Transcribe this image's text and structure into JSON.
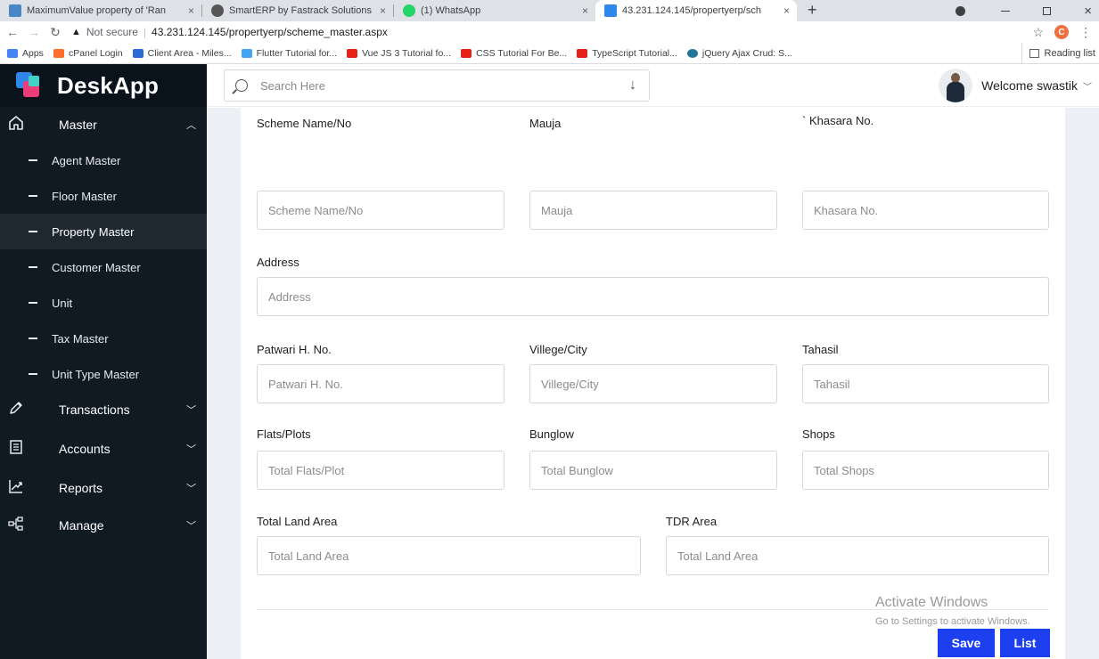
{
  "browser": {
    "tabs": [
      {
        "title": "MaximumValue property of 'Ran",
        "close": "×",
        "active": false,
        "fav_color": "#4a86c5"
      },
      {
        "title": "SmartERP by Fastrack Solutions...",
        "close": "×",
        "active": false,
        "fav_color": "#555555"
      },
      {
        "title": "(1) WhatsApp",
        "close": "×",
        "active": false,
        "fav_color": "#25d366"
      },
      {
        "title": "43.231.124.145/propertyerp/sch",
        "close": "×",
        "active": true,
        "fav_color": "#2f86eb"
      }
    ],
    "new_tab": "+",
    "url_prefix": "Not secure",
    "url": "43.231.124.145/propertyerp/scheme_master.aspx",
    "profile_initial": "C",
    "bookmarks": [
      {
        "label": "Apps",
        "color": "#4285f4"
      },
      {
        "label": "cPanel Login",
        "color": "#ff6c2c"
      },
      {
        "label": "Client Area - Miles...",
        "color": "#2d6bd4"
      },
      {
        "label": "Flutter Tutorial for...",
        "color": "#42a5f5"
      },
      {
        "label": "Vue JS 3 Tutorial fo...",
        "color": "#e62117"
      },
      {
        "label": "CSS Tutorial For Be...",
        "color": "#e62117"
      },
      {
        "label": "TypeScript Tutorial...",
        "color": "#e62117"
      },
      {
        "label": "jQuery Ajax Crud: S...",
        "color": "#21759b"
      }
    ],
    "reading_list": "Reading list"
  },
  "sidebar": {
    "brand": "DeskApp",
    "master": {
      "label": "Master",
      "icon": "home-icon"
    },
    "sub_items": [
      {
        "label": "Agent Master",
        "active": false
      },
      {
        "label": "Floor Master",
        "active": false
      },
      {
        "label": "Property Master",
        "active": true
      },
      {
        "label": "Customer Master",
        "active": false
      },
      {
        "label": "Unit",
        "active": false
      },
      {
        "label": "Tax Master",
        "active": false
      },
      {
        "label": "Unit Type Master",
        "active": false
      }
    ],
    "sections": [
      {
        "label": "Transactions",
        "icon": "pencil-icon"
      },
      {
        "label": "Accounts",
        "icon": "document-icon"
      },
      {
        "label": "Reports",
        "icon": "chart-icon"
      },
      {
        "label": "Manage",
        "icon": "hierarchy-icon"
      }
    ]
  },
  "header": {
    "search_placeholder": "Search Here",
    "welcome": "Welcome swastik"
  },
  "form": {
    "scheme_name": {
      "label": "Scheme Name/No",
      "placeholder": "Scheme Name/No"
    },
    "mauja": {
      "label": "Mauja",
      "placeholder": "Mauja"
    },
    "khasara": {
      "label": "` Khasara No.",
      "placeholder": "Khasara No."
    },
    "address": {
      "label": "Address",
      "placeholder": "Address"
    },
    "patwari": {
      "label": "Patwari H. No.",
      "placeholder": "Patwari H. No."
    },
    "village": {
      "label": "Villege/City",
      "placeholder": "Villege/City"
    },
    "tahasil": {
      "label": "Tahasil",
      "placeholder": "Tahasil"
    },
    "flats": {
      "label": "Flats/Plots",
      "placeholder": "Total Flats/Plot"
    },
    "bunglow": {
      "label": "Bunglow",
      "placeholder": "Total Bunglow"
    },
    "shops": {
      "label": "Shops",
      "placeholder": "Total Shops"
    },
    "land_area": {
      "label": "Total Land Area",
      "placeholder": "Total Land Area"
    },
    "tdr_area": {
      "label": "TDR Area",
      "placeholder": "Total Land Area"
    },
    "save_label": "Save",
    "list_label": "List"
  },
  "watermark": {
    "line1": "Activate Windows",
    "line2": "Go to Settings to activate Windows."
  }
}
